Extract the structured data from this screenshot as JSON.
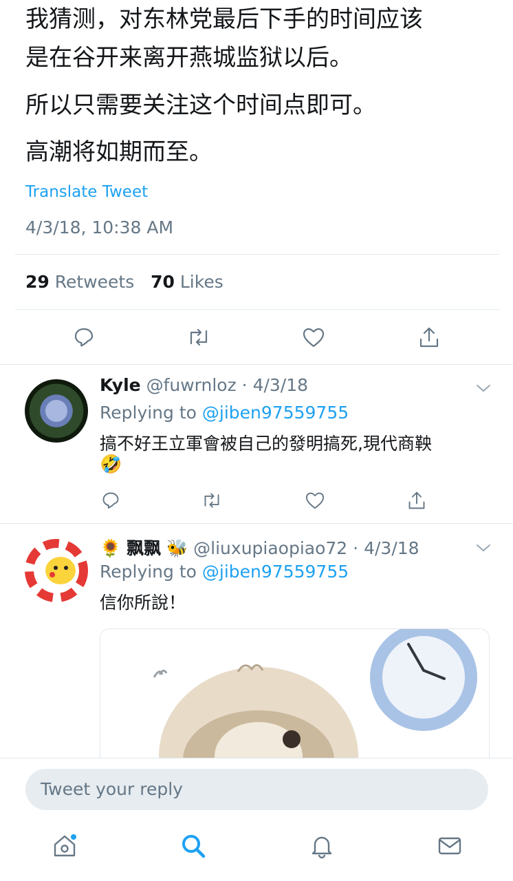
{
  "tweet": {
    "lines": [
      "我猜测，对东林党最后下手的时间应该",
      "是在谷开来离开燕城监狱以后。",
      "所以只需要关注这个时间点即可。",
      "高潮将如期而至。"
    ],
    "translate_label": "Translate Tweet",
    "timestamp": "4/3/18, 10:38 AM",
    "retweets_count": "29",
    "retweets_label": "Retweets",
    "likes_count": "70",
    "likes_label": "Likes"
  },
  "replies": [
    {
      "name": "Kyle",
      "handle": "@fuwrnloz",
      "separator": "·",
      "date": "4/3/18",
      "replying_label": "Replying to",
      "replying_to": "@jiben97559755",
      "text": "搞不好王立軍會被自己的發明搞死,現代商鞅",
      "emoji": "🤣"
    },
    {
      "name_prefix": "🌻",
      "name": "飘飘",
      "name_suffix": "🐝",
      "handle": "@liuxupiaopiao72",
      "separator": "·",
      "date": "4/3/18",
      "replying_label": "Replying to",
      "replying_to": "@jiben97559755",
      "text": "信你所說！"
    }
  ],
  "composer": {
    "placeholder": "Tweet your reply"
  },
  "colors": {
    "accent": "#1da1f2",
    "muted": "#657786",
    "divider": "#e1e8ed",
    "input_bg": "#e6ecf0"
  },
  "icons": {
    "action_bar": [
      "reply-icon",
      "retweet-icon",
      "like-icon",
      "share-icon"
    ],
    "bottom_nav": [
      "home-icon",
      "search-icon",
      "notifications-icon",
      "messages-icon"
    ]
  }
}
